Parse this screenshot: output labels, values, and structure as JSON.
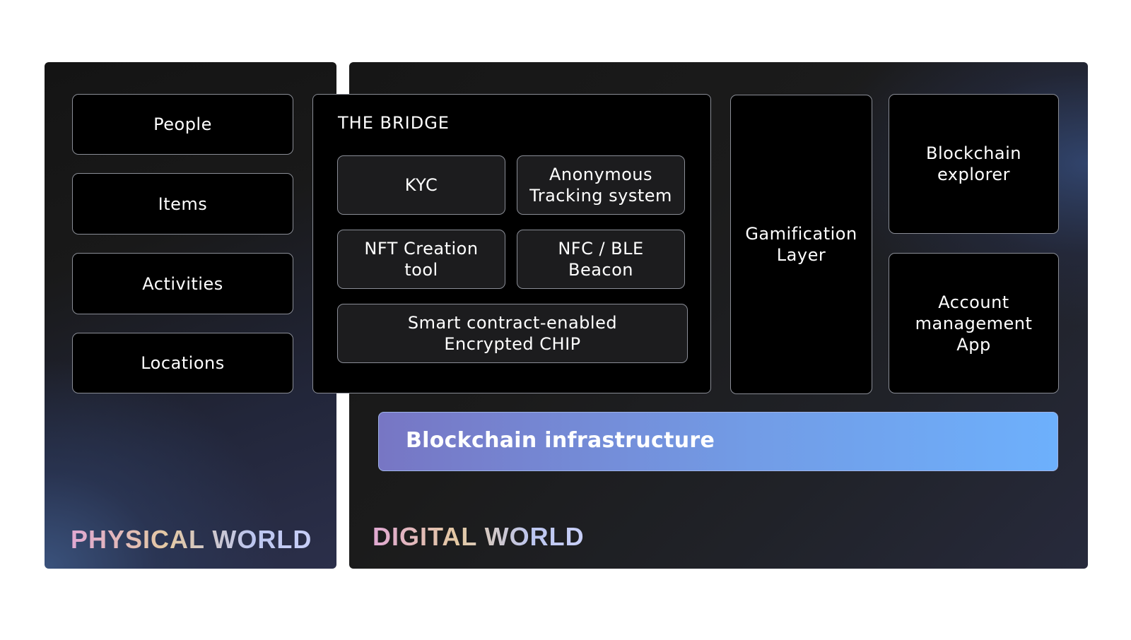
{
  "physical_world": {
    "label": "PHYSICAL WORLD",
    "items": [
      "People",
      "Items",
      "Activities",
      "Locations"
    ]
  },
  "bridge": {
    "title": "THE BRIDGE",
    "components": [
      "KYC",
      "Anonymous Tracking system",
      "NFT Creation tool",
      "NFC / BLE Beacon",
      "Smart contract-enabled Encrypted CHIP"
    ]
  },
  "digital_world": {
    "label": "DIGITAL WORLD",
    "gamification": "Gamification Layer",
    "blockchain_explorer": "Blockchain explorer",
    "account_app": "Account management App",
    "infrastructure": "Blockchain infrastructure"
  },
  "colors": {
    "background": "#ffffff",
    "panel_dark": "#161616",
    "panel_glow": "#3a527c",
    "box_fill": "#000000",
    "box_border": "#8a8d96",
    "infra_gradient_start": "#7776c4",
    "infra_gradient_end": "#6db0fc",
    "world_label_gradient": [
      "#e0a8d2",
      "#e4c9a3",
      "#bcc6ef"
    ]
  }
}
